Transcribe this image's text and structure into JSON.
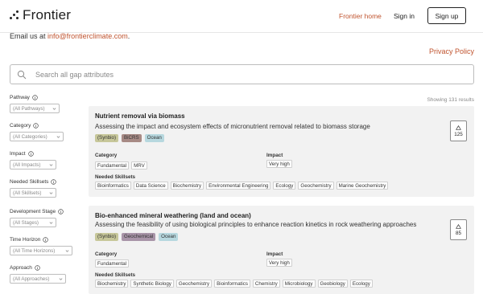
{
  "header": {
    "brand": "Frontier",
    "nav_home": "Frontier home",
    "nav_signin": "Sign in",
    "nav_signup": "Sign up"
  },
  "contact": {
    "prefix": "Email us at ",
    "email": "info@frontierclimate.com",
    "suffix": "."
  },
  "privacy_link": "Privacy Policy",
  "search": {
    "placeholder": "Search all gap attributes"
  },
  "results_count": "Showing 131 results",
  "filters": [
    {
      "label": "Pathway",
      "value": "(All Pathways)"
    },
    {
      "label": "Category",
      "value": "(All Categories)"
    },
    {
      "label": "Impact",
      "value": "(All Impacts)"
    },
    {
      "label": "Needed Skillsets",
      "value": "(All Skillsets)"
    },
    {
      "label": "Development Stage",
      "value": "(All Stages)"
    },
    {
      "label": "Time Horizon",
      "value": "(All Time Horizons)"
    },
    {
      "label": "Approach",
      "value": "(All Approaches)"
    }
  ],
  "labels": {
    "category": "Category",
    "impact": "Impact",
    "skillsets": "Needed Skillsets"
  },
  "cards": [
    {
      "title": "Nutrient removal via biomass",
      "description": "Assessing the impact and ecosystem effects of micronutrient removal related to biomass storage",
      "tags": [
        "(Synbio)",
        "BiCRS",
        "Ocean"
      ],
      "categories": [
        "Fundamental",
        "MRV"
      ],
      "impact": "Very high",
      "skillsets": [
        "Bioinformatics",
        "Data Science",
        "Biochemistry",
        "Environmental Engineering",
        "Ecology",
        "Geochemistry",
        "Marine Geochemistry"
      ],
      "votes": "125"
    },
    {
      "title": "Bio-enhanced mineral weathering (land and ocean)",
      "description": "Assessing the feasibility of using biological principles to enhance reaction kinetics in rock weathering approaches",
      "tags": [
        "(Synbio)",
        "Geochemical",
        "Ocean"
      ],
      "categories": [
        "Fundamental"
      ],
      "impact": "Very high",
      "skillsets": [
        "Biochemistry",
        "Synthetic Biology",
        "Geochemistry",
        "Bioinformatics",
        "Chemistry",
        "Microbiology",
        "Geobiology",
        "Ecology"
      ],
      "votes": "85"
    }
  ],
  "colors": {
    "accent": "#c0542f",
    "card_bg": "#f2f2f2",
    "tag_synbio": "#c7c79a",
    "tag_bicrs": "#a78a85",
    "tag_ocean": "#b7d8df",
    "tag_geochemical": "#a894a8"
  },
  "icons": {
    "brand": "frontier-dots-icon",
    "search": "search-icon",
    "info": "info-icon",
    "chevron": "chevron-down-icon",
    "upvote": "upvote-triangle-icon"
  }
}
